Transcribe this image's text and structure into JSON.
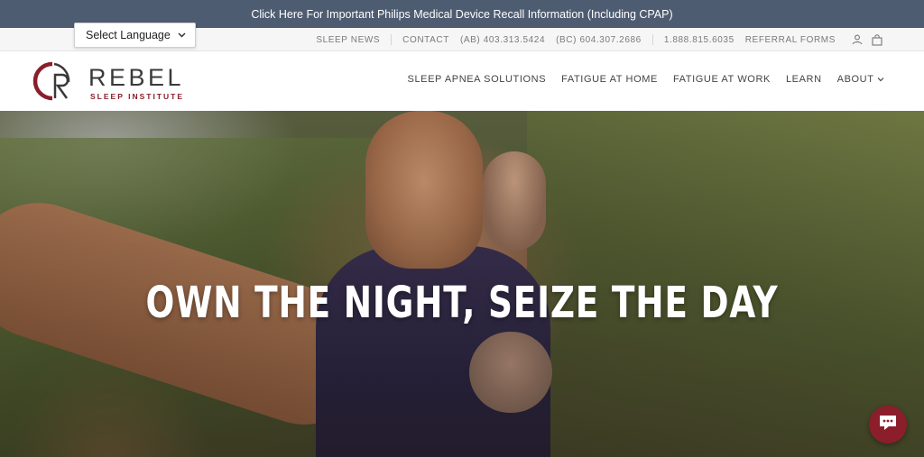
{
  "announcement": {
    "text": "Click Here For Important Philips Medical Device Recall Information (Including CPAP)"
  },
  "language_select": {
    "label": "Select Language"
  },
  "utility_nav": {
    "sleep_news": "SLEEP NEWS",
    "contact": "CONTACT",
    "phone_ab": "(AB) 403.313.5424",
    "phone_bc": "(BC) 604.307.2686",
    "phone_toll": "1.888.815.6035",
    "referral_forms": "REFERRAL FORMS"
  },
  "logo": {
    "word": "REBEL",
    "sub": "SLEEP INSTITUTE"
  },
  "main_nav": [
    {
      "label": "SLEEP APNEA SOLUTIONS"
    },
    {
      "label": "FATIGUE AT HOME"
    },
    {
      "label": "FATIGUE AT WORK"
    },
    {
      "label": "LEARN"
    },
    {
      "label": "ABOUT"
    }
  ],
  "about_chevron": "⌄",
  "hero": {
    "title": "OWN THE NIGHT, SEIZE THE DAY"
  },
  "icons": {
    "account": "user-icon",
    "cart": "shopping-bag-icon",
    "chat": "chat-bubble-icon",
    "select": "chevron-down-icon"
  },
  "colors": {
    "brand": "#8b1e2b",
    "announcement_bg": "#4d5c70"
  }
}
